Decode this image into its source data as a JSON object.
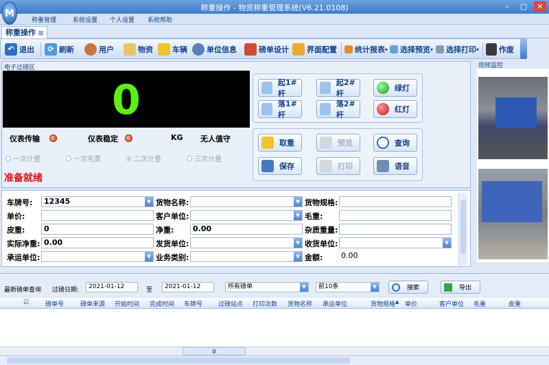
{
  "window": {
    "title": "称重操作 - 物资称重管理系统(V6.21.0108)",
    "logo": "M"
  },
  "menu": [
    "称重管理",
    "系统设置",
    "个人设置",
    "系统帮助"
  ],
  "tab": {
    "label": "称重操作",
    "close": "⊠"
  },
  "toolbar": {
    "exit": "退出",
    "refresh": "刷新",
    "user": "用户",
    "goods": "物资",
    "vehicle": "车辆",
    "unit_info": "单位信息",
    "ticket_design": "磅单设计",
    "ui_config": "界面配置",
    "stats_report": "统计报表",
    "select_preview": "选择预览",
    "select_print": "选择打印",
    "void": "作废"
  },
  "weigh_panel": {
    "title": "电子过磅区",
    "weight": "0",
    "meter_transmit": "仪表传输",
    "meter_stable": "仪表稳定",
    "unit": "KG",
    "unattended": "无人值守",
    "modes": [
      "一次计量",
      "一次毛重",
      "二次计量",
      "三次计量"
    ],
    "status": "准备就绪"
  },
  "controls": {
    "raise1": "起1#杆",
    "raise2": "起2#杆",
    "green": "绿灯",
    "lower1": "落1#杆",
    "lower2": "落2#杆",
    "red": "红灯",
    "weigh": "取重",
    "preview": "预览",
    "query": "查询",
    "save": "保存",
    "print": "打印",
    "voice": "语音"
  },
  "form": {
    "plate_label": "车牌号:",
    "plate_value": "12345",
    "goods_name_label": "货物名称:",
    "goods_spec_label": "货物规格:",
    "price_label": "单价:",
    "customer_label": "客户单位:",
    "gross_label": "毛重:",
    "tare_label": "皮重:",
    "tare_value": "0",
    "net_label": "净重:",
    "net_value": "0.00",
    "impurity_label": "杂质重量:",
    "actual_net_label": "实际净重:",
    "actual_net_value": "0.00",
    "sender_label": "发货单位:",
    "receiver_label": "收货单位:",
    "carrier_label": "承运单位:",
    "business_label": "业务类别:",
    "amount_label": "金额:",
    "amount_value": "0.00"
  },
  "query": {
    "title": "最新磅单查询",
    "date_label": "过磅日期:",
    "from": "2021-01-12",
    "to_label": "至",
    "to": "2021-01-12",
    "type": "所有磅单",
    "limit": "前10条",
    "search": "搜索",
    "export": "导出"
  },
  "grid": {
    "columns": [
      "磅单号",
      "磅单来源",
      "开始时间",
      "完成时间",
      "车牌号",
      "过磅站点",
      "打印次数",
      "货物名称",
      "承运单位",
      "货物规格",
      "单价",
      "客户单位",
      "毛重",
      "皮重"
    ],
    "sum_value": "0"
  },
  "video": {
    "title": "视频监控"
  }
}
